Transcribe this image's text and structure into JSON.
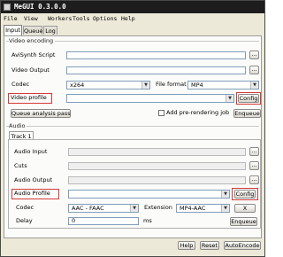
{
  "window": {
    "title": "MeGUI 0.3.0.0"
  },
  "menu": [
    "File",
    "View",
    "Workers",
    "Tools",
    "Options",
    "Help"
  ],
  "main_tabs": [
    "Input",
    "Queue",
    "Log"
  ],
  "video": {
    "group_label": "Video encoding",
    "avisynth_label": "AviSynth Script",
    "avisynth_value": "",
    "video_output_label": "Video Output",
    "video_output_value": "",
    "codec_label": "Codec",
    "codec_value": "x264",
    "file_format_label": "File format",
    "file_format_value": "MP4",
    "profile_label": "Video profile",
    "profile_value": "",
    "config_label": "Config",
    "queue_analysis_label": "Queue analysis pass",
    "add_prerender_label": "Add pre-rendering job",
    "enqueue_label": "Enqueue",
    "browse_label": "..."
  },
  "audio": {
    "group_label": "Audio",
    "track_tab": "Track 1",
    "audio_input_label": "Audio Input",
    "audio_input_value": "",
    "cuts_label": "Cuts",
    "cuts_value": "",
    "audio_output_label": "Audio Output",
    "audio_output_value": "",
    "profile_label": "Audio Profile",
    "profile_value": "",
    "config_label": "Config",
    "codec_label": "Codec",
    "codec_value": "AAC - FAAC",
    "extension_label": "Extension",
    "extension_value": "MP4-AAC",
    "delay_label": "Delay",
    "delay_value": "0",
    "delay_unit": "ms",
    "enqueue_label": "Enqueue",
    "clear_label": "X",
    "browse_label": "..."
  },
  "bottom": {
    "help_label": "Help",
    "reset_label": "Reset",
    "autoencode_label": "AutoEncode"
  },
  "colors": {
    "highlight": "#d43a3a",
    "titlebar": "#1d1d1d"
  }
}
